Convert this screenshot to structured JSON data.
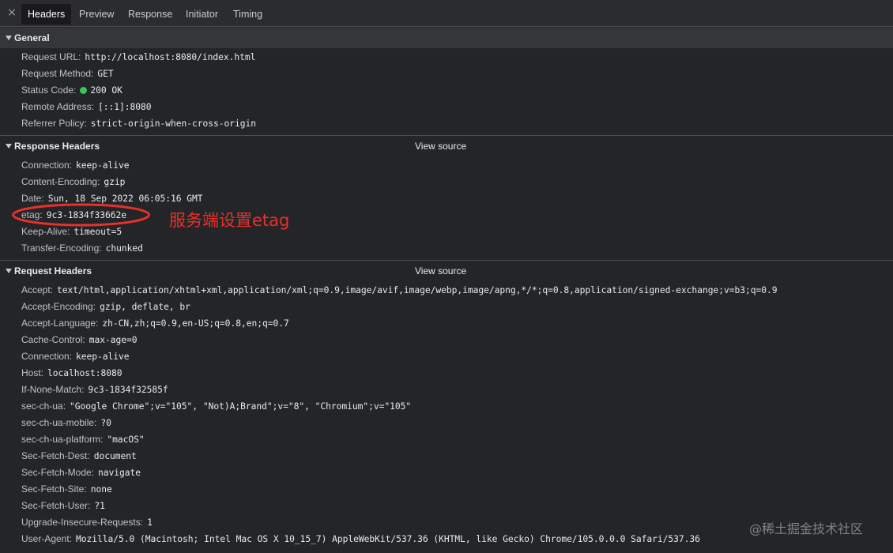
{
  "tabs": {
    "close_glyph": "×",
    "items": [
      "Headers",
      "Preview",
      "Response",
      "Initiator",
      "Timing"
    ],
    "active": "Headers"
  },
  "general": {
    "title": "General",
    "rows": [
      {
        "key": "Request URL:",
        "value": "http://localhost:8080/index.html"
      },
      {
        "key": "Request Method:",
        "value": "GET"
      },
      {
        "key": "Status Code:",
        "value": "200 OK",
        "status_color": "#34c759"
      },
      {
        "key": "Remote Address:",
        "value": "[::1]:8080"
      },
      {
        "key": "Referrer Policy:",
        "value": "strict-origin-when-cross-origin"
      }
    ]
  },
  "response_headers": {
    "title": "Response Headers",
    "view_source": "View source",
    "rows": [
      {
        "key": "Connection:",
        "value": "keep-alive"
      },
      {
        "key": "Content-Encoding:",
        "value": "gzip"
      },
      {
        "key": "Date:",
        "value": "Sun, 18 Sep 2022 06:05:16 GMT"
      },
      {
        "key": "etag:",
        "value": "9c3-1834f33662e"
      },
      {
        "key": "Keep-Alive:",
        "value": "timeout=5"
      },
      {
        "key": "Transfer-Encoding:",
        "value": "chunked"
      }
    ]
  },
  "request_headers": {
    "title": "Request Headers",
    "view_source": "View source",
    "rows": [
      {
        "key": "Accept:",
        "value": "text/html,application/xhtml+xml,application/xml;q=0.9,image/avif,image/webp,image/apng,*/*;q=0.8,application/signed-exchange;v=b3;q=0.9"
      },
      {
        "key": "Accept-Encoding:",
        "value": "gzip, deflate, br"
      },
      {
        "key": "Accept-Language:",
        "value": "zh-CN,zh;q=0.9,en-US;q=0.8,en;q=0.7"
      },
      {
        "key": "Cache-Control:",
        "value": "max-age=0"
      },
      {
        "key": "Connection:",
        "value": "keep-alive"
      },
      {
        "key": "Host:",
        "value": "localhost:8080"
      },
      {
        "key": "If-None-Match:",
        "value": "9c3-1834f32585f"
      },
      {
        "key": "sec-ch-ua:",
        "value": "\"Google Chrome\";v=\"105\", \"Not)A;Brand\";v=\"8\", \"Chromium\";v=\"105\""
      },
      {
        "key": "sec-ch-ua-mobile:",
        "value": "?0"
      },
      {
        "key": "sec-ch-ua-platform:",
        "value": "\"macOS\""
      },
      {
        "key": "Sec-Fetch-Dest:",
        "value": "document"
      },
      {
        "key": "Sec-Fetch-Mode:",
        "value": "navigate"
      },
      {
        "key": "Sec-Fetch-Site:",
        "value": "none"
      },
      {
        "key": "Sec-Fetch-User:",
        "value": "?1"
      },
      {
        "key": "Upgrade-Insecure-Requests:",
        "value": "1"
      },
      {
        "key": "User-Agent:",
        "value": "Mozilla/5.0 (Macintosh; Intel Mac OS X 10_15_7) AppleWebKit/537.36 (KHTML, like Gecko) Chrome/105.0.0.0 Safari/537.36"
      }
    ]
  },
  "annotation": {
    "text": "服务端设置etag",
    "color": "#e8312a"
  },
  "watermark": "@稀土掘金技术社区"
}
